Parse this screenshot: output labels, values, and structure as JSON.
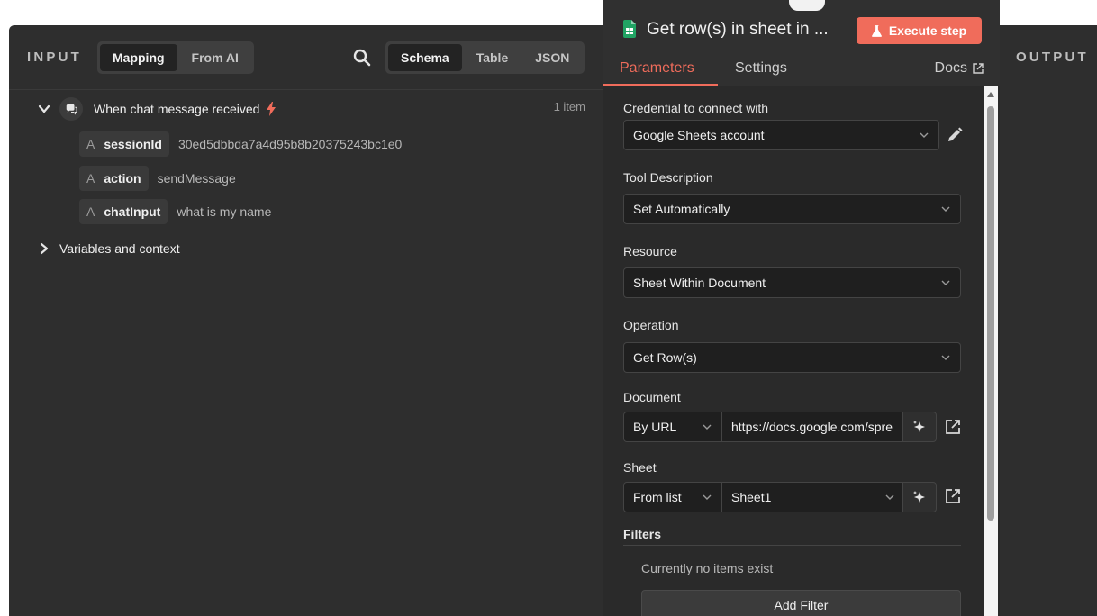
{
  "input_panel": {
    "title": "INPUT",
    "mode_tabs": [
      {
        "label": "Mapping",
        "active": true
      },
      {
        "label": "From AI",
        "active": false
      }
    ],
    "view_tabs": [
      {
        "label": "Schema",
        "active": true
      },
      {
        "label": "Table",
        "active": false
      },
      {
        "label": "JSON",
        "active": false
      }
    ],
    "trigger": {
      "label": "When chat message received",
      "count": "1 item"
    },
    "fields": [
      {
        "type": "A",
        "key": "sessionId",
        "value": "30ed5dbbda7a4d95b8b20375243bc1e0"
      },
      {
        "type": "A",
        "key": "action",
        "value": "sendMessage"
      },
      {
        "type": "A",
        "key": "chatInput",
        "value": "what is my name"
      }
    ],
    "variables_label": "Variables and context"
  },
  "node": {
    "title": "Get row(s) in sheet in ...",
    "execute_label": "Execute step",
    "tabs": [
      {
        "label": "Parameters",
        "active": true
      },
      {
        "label": "Settings",
        "active": false
      }
    ],
    "docs_label": "Docs",
    "params": {
      "credential_label": "Credential to connect with",
      "credential_value": "Google Sheets account",
      "tool_desc_label": "Tool Description",
      "tool_desc_value": "Set Automatically",
      "resource_label": "Resource",
      "resource_value": "Sheet Within Document",
      "operation_label": "Operation",
      "operation_value": "Get Row(s)",
      "document_label": "Document",
      "document_mode": "By URL",
      "document_url": "https://docs.google.com/spre",
      "sheet_label": "Sheet",
      "sheet_mode": "From list",
      "sheet_value": "Sheet1",
      "filters_label": "Filters",
      "filters_empty": "Currently no items exist",
      "add_filter_label": "Add Filter"
    }
  },
  "output_panel": {
    "title": "OUTPUT"
  },
  "colors": {
    "accent": "#f06c5b",
    "panel_bg": "#2e2e2e",
    "input_bg": "#1f1f1f"
  }
}
